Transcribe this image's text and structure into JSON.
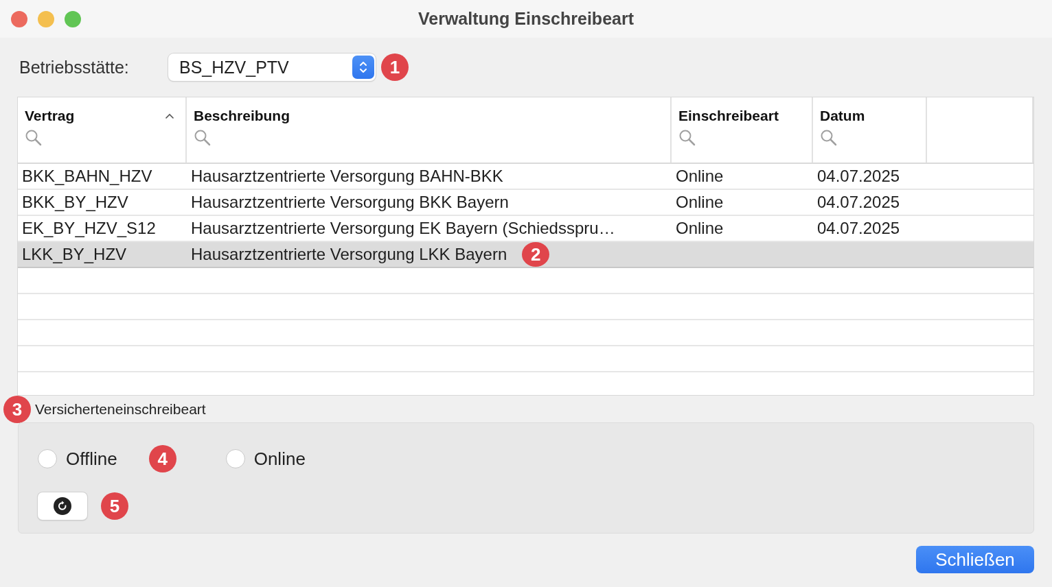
{
  "window": {
    "title": "Verwaltung Einschreibeart"
  },
  "site": {
    "label": "Betriebsstätte:",
    "value": "BS_HZV_PTV",
    "callout": "1"
  },
  "table": {
    "columns": [
      {
        "label": "Vertrag",
        "sorted": true
      },
      {
        "label": "Beschreibung",
        "sorted": false
      },
      {
        "label": "Einschreibeart",
        "sorted": false
      },
      {
        "label": "Datum",
        "sorted": false
      }
    ],
    "rows": [
      {
        "cells": [
          "BKK_BAHN_HZV",
          "Hausarztzentrierte Versorgung BAHN-BKK",
          "Online",
          "04.07.2025"
        ],
        "selected": false
      },
      {
        "cells": [
          "BKK_BY_HZV",
          "Hausarztzentrierte Versorgung BKK Bayern",
          "Online",
          "04.07.2025"
        ],
        "selected": false
      },
      {
        "cells": [
          "EK_BY_HZV_S12",
          "Hausarztzentrierte Versorgung EK Bayern (Schiedsspru…",
          "Online",
          "04.07.2025"
        ],
        "selected": false
      },
      {
        "cells": [
          "LKK_BY_HZV",
          "Hausarztzentrierte Versorgung LKK Bayern"
        ],
        "selected": true,
        "callout": "2"
      }
    ]
  },
  "group": {
    "title": "Versicherteneinschreibeart",
    "callout": "3",
    "options": [
      {
        "label": "Offline",
        "selected": false
      },
      {
        "label": "Online",
        "selected": false
      }
    ],
    "options_callout": "4",
    "reset_callout": "5"
  },
  "buttons": [
    {
      "label": "Schließen",
      "default": true
    }
  ]
}
